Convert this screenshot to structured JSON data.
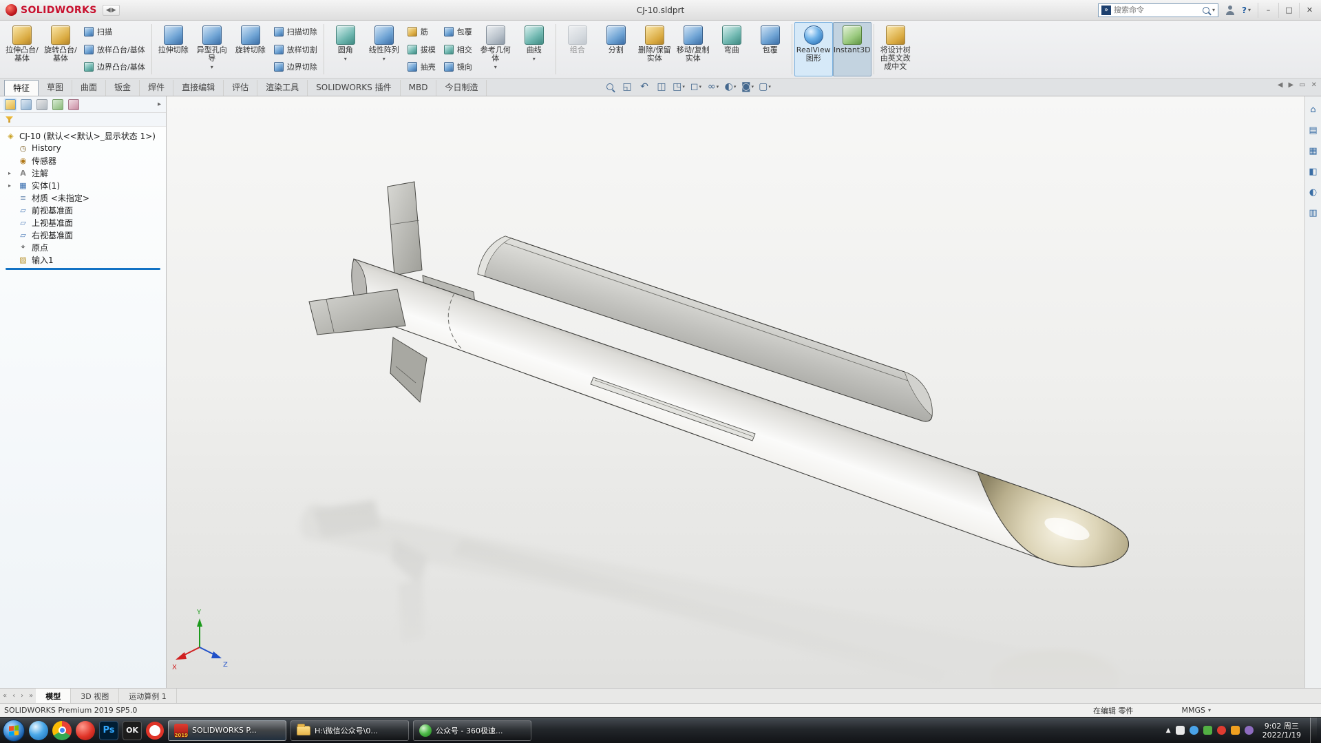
{
  "glyphs": {
    "caret": "▾",
    "expand": "▸",
    "back": "◀",
    "forward": "▶",
    "min": "–",
    "max": "□",
    "close": "✕",
    "float": "▭",
    "nav_first": "«",
    "nav_prev": "‹",
    "nav_next": "›",
    "nav_last": "»",
    "tray_up": "▲",
    "panel_more": "▸",
    "search_go": "»"
  },
  "titlebar": {
    "app_name": "SOLIDWORKS",
    "doc_title": "CJ-10.sldprt",
    "search_placeholder": "搜索命令",
    "help_label": "?"
  },
  "ribbon": {
    "big": [
      "拉伸凸台/基体",
      "旋转凸台/基体",
      "拉伸切除",
      "异型孔向导",
      "旋转切除",
      "圆角",
      "线性阵列",
      "参考几何体",
      "曲线",
      "组合",
      "分割",
      "删除/保留实体",
      "移动/复制实体",
      "弯曲",
      "包覆",
      "RealView图形",
      "Instant3D",
      "将设计树由英文改成中文"
    ],
    "stack_boss": [
      "扫描",
      "放样凸台/基体",
      "边界凸台/基体"
    ],
    "stack_cut": [
      "扫描切除",
      "放样切割",
      "边界切除"
    ],
    "stack_feature": [
      "筋",
      "拔模",
      "抽壳"
    ],
    "stack_wrap": [
      "包覆",
      "相交",
      "镜向"
    ]
  },
  "tabs": [
    "特征",
    "草图",
    "曲面",
    "钣金",
    "焊件",
    "直接编辑",
    "评估",
    "渲染工具",
    "SOLIDWORKS 插件",
    "MBD",
    "今日制造"
  ],
  "hud": {
    "glyphs": [
      "",
      "◱",
      "↶",
      "◫",
      "◳",
      "◻",
      "∞",
      "◐",
      "◙",
      "▢"
    ]
  },
  "tree": {
    "root": "CJ-10 (默认<<默认>_显示状态 1>)",
    "items": [
      {
        "glyph": "◷",
        "label": "History"
      },
      {
        "glyph": "◉",
        "label": "传感器"
      },
      {
        "glyph": "A",
        "label": "注解"
      },
      {
        "glyph": "▦",
        "label": "实体(1)"
      },
      {
        "glyph": "≡",
        "label": "材质 <未指定>"
      },
      {
        "glyph": "▱",
        "label": "前视基准面"
      },
      {
        "glyph": "▱",
        "label": "上视基准面"
      },
      {
        "glyph": "▱",
        "label": "右视基准面"
      },
      {
        "glyph": "⌖",
        "label": "原点"
      },
      {
        "glyph": "▨",
        "label": "输入1"
      }
    ]
  },
  "taskpane": {
    "glyphs": [
      "⌂",
      "▤",
      "▦",
      "◧",
      "◐",
      "▥"
    ]
  },
  "bottom_tabs": [
    "模型",
    "3D 视图",
    "运动算例 1"
  ],
  "statusbar": {
    "left": "SOLIDWORKS Premium 2019 SP5.0",
    "editing": "在编辑 零件",
    "units": "MMGS"
  },
  "taskbar": {
    "ps_label": "Ps",
    "ok_label": "OK",
    "sw_button": "SOLIDWORKS P...",
    "sw_year": "2019",
    "folder_button": "H:\\微信公众号\\0...",
    "browser_button": "公众号 - 360极速...",
    "clock_time": "9:02 周三",
    "clock_date": "2022/1/19"
  },
  "viewport": {
    "triad": {
      "x": "X",
      "y": "Y",
      "z": "Z"
    }
  }
}
